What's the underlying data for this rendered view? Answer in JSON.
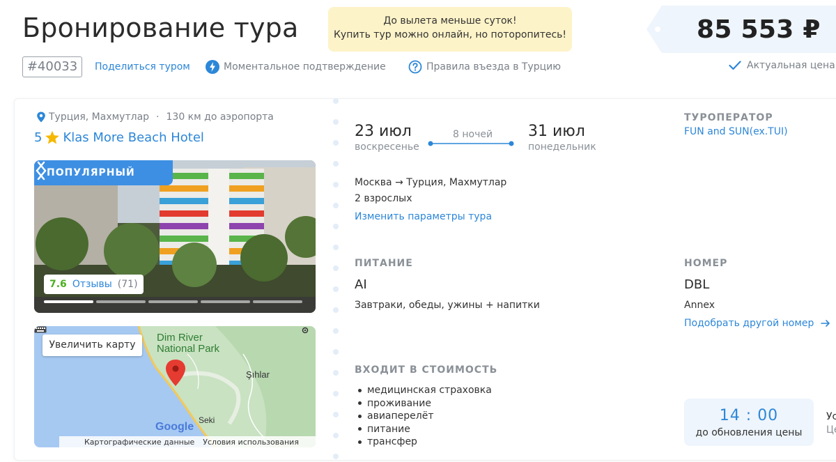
{
  "header": {
    "title": "Бронирование тура",
    "alert_line1": "До вылета меньше суток!",
    "alert_line2": "Купить тур можно онлайн, но поторопитесь!",
    "price": "85 553 ₽",
    "tour_id": "#40033",
    "share_label": "Поделиться туром",
    "instant_label": "Моментальное подтверждение",
    "rules_label": "Правила въезда в Турцию",
    "actual_price_label": "Актуальная цена"
  },
  "hotel": {
    "location": "Турция, Махмутлар",
    "airport_distance": "130 км до аэропорта",
    "stars": "5",
    "name": "Klas More Beach Hotel",
    "badge": "ПОПУЛЯРНЫЙ",
    "rating_score": "7.6",
    "reviews_label": "Отзывы",
    "reviews_count": "(71)",
    "photo_count": 5,
    "photo_active_index": 0
  },
  "map": {
    "zoom_label": "Увеличить карту",
    "park_line1": "Dim River",
    "park_line2": "National Park",
    "place1": "Şıhlar",
    "place2": "Seki",
    "google": "Google",
    "map_data": "Картографические данные",
    "terms": "Условия использования"
  },
  "dates": {
    "depart_date": "23 июл",
    "depart_day": "воскресенье",
    "nights": "8 ночей",
    "return_date": "31 июл",
    "return_day": "понедельник"
  },
  "params": {
    "route": "Москва → Турция, Махмутлар",
    "adults": "2 взрослых",
    "change_label": "Изменить параметры тура"
  },
  "operator": {
    "label": "ТУРОПЕРАТОР",
    "name": "FUN and SUN(ex.TUI)"
  },
  "meal": {
    "label": "ПИТАНИЕ",
    "code": "AI",
    "description": "Завтраки, обеды, ужины + напитки"
  },
  "room": {
    "label": "НОМЕР",
    "code": "DBL",
    "description": "Annex",
    "change_label": "Подобрать другой номер"
  },
  "includes": {
    "label": "ВХОДИТ В СТОИМОСТЬ",
    "items": [
      "медицинская страховка",
      "проживание",
      "авиаперелёт",
      "питание",
      "трансфер"
    ]
  },
  "timer": {
    "time": "14 : 00",
    "caption": "до обновления цены",
    "cut_line1": "Ус",
    "cut_line2": "Це"
  },
  "colors": {
    "accent": "#2d87d8",
    "badge_bg": "#3d8fe3",
    "alert_bg": "#fdf3c8",
    "price_bg": "#eef5fc",
    "rating_green": "#4caf1f"
  }
}
